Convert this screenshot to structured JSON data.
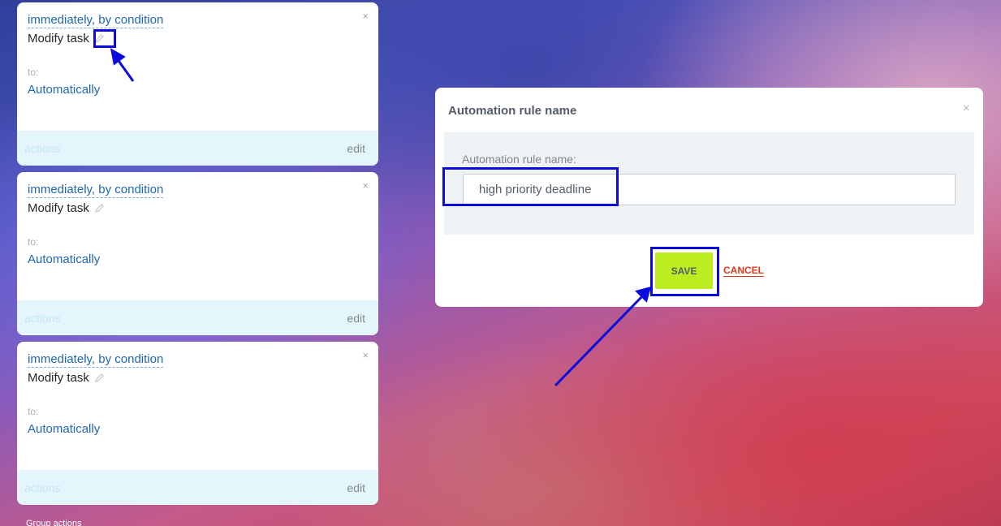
{
  "cards": [
    {
      "trigger": "immediately, by condition",
      "task": "Modify task",
      "to_label": "to:",
      "target": "Automatically",
      "actions_label": "actions",
      "edit_label": "edit",
      "close_glyph": "×",
      "pencil_icon": "pencil-icon"
    },
    {
      "trigger": "immediately, by condition",
      "task": "Modify task",
      "to_label": "to:",
      "target": "Automatically",
      "actions_label": "actions",
      "edit_label": "edit",
      "close_glyph": "×",
      "pencil_icon": "pencil-icon"
    },
    {
      "trigger": "immediately, by condition",
      "task": "Modify task",
      "to_label": "to:",
      "target": "Automatically",
      "actions_label": "actions",
      "edit_label": "edit",
      "close_glyph": "×",
      "pencil_icon": "pencil-icon"
    }
  ],
  "group_actions_label": "Group actions",
  "modal": {
    "title": "Automation rule name",
    "close_glyph": "×",
    "field_label": "Automation rule name:",
    "field_value": "high priority deadline",
    "save_label": "SAVE",
    "cancel_label": "CANCEL"
  },
  "colors": {
    "link_blue": "#2067b0",
    "save_green": "#bbed21",
    "cancel_red": "#e0361b",
    "annotation_blue": "#0b0bdc"
  }
}
